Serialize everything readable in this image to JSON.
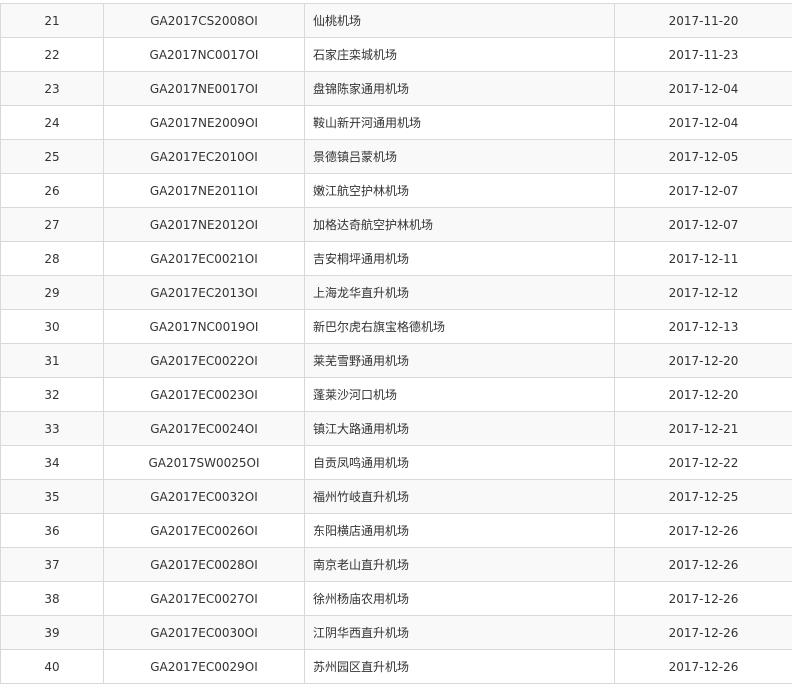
{
  "rows": [
    {
      "no": "21",
      "code": "GA2017CS2008OI",
      "name": "仙桃机场",
      "date": "2017-11-20"
    },
    {
      "no": "22",
      "code": "GA2017NC0017OI",
      "name": "石家庄栾城机场",
      "date": "2017-11-23"
    },
    {
      "no": "23",
      "code": "GA2017NE0017OI",
      "name": "盘锦陈家通用机场",
      "date": "2017-12-04"
    },
    {
      "no": "24",
      "code": "GA2017NE2009OI",
      "name": "鞍山新开河通用机场",
      "date": "2017-12-04"
    },
    {
      "no": "25",
      "code": "GA2017EC2010OI",
      "name": "景德镇吕蒙机场",
      "date": "2017-12-05"
    },
    {
      "no": "26",
      "code": "GA2017NE2011OI",
      "name": "嫩江航空护林机场",
      "date": "2017-12-07"
    },
    {
      "no": "27",
      "code": "GA2017NE2012OI",
      "name": "加格达奇航空护林机场",
      "date": "2017-12-07"
    },
    {
      "no": "28",
      "code": "GA2017EC0021OI",
      "name": "吉安桐坪通用机场",
      "date": "2017-12-11"
    },
    {
      "no": "29",
      "code": "GA2017EC2013OI",
      "name": "上海龙华直升机场",
      "date": "2017-12-12"
    },
    {
      "no": "30",
      "code": "GA2017NC0019OI",
      "name": "新巴尔虎右旗宝格德机场",
      "date": "2017-12-13"
    },
    {
      "no": "31",
      "code": "GA2017EC0022OI",
      "name": "莱芜雪野通用机场",
      "date": "2017-12-20"
    },
    {
      "no": "32",
      "code": "GA2017EC0023OI",
      "name": "蓬莱沙河口机场",
      "date": "2017-12-20"
    },
    {
      "no": "33",
      "code": "GA2017EC0024OI",
      "name": "镇江大路通用机场",
      "date": "2017-12-21"
    },
    {
      "no": "34",
      "code": "GA2017SW0025OI",
      "name": "自贡凤鸣通用机场",
      "date": "2017-12-22"
    },
    {
      "no": "35",
      "code": "GA2017EC0032OI",
      "name": "福州竹岐直升机场",
      "date": "2017-12-25"
    },
    {
      "no": "36",
      "code": "GA2017EC0026OI",
      "name": "东阳横店通用机场",
      "date": "2017-12-26"
    },
    {
      "no": "37",
      "code": "GA2017EC0028OI",
      "name": "南京老山直升机场",
      "date": "2017-12-26"
    },
    {
      "no": "38",
      "code": "GA2017EC0027OI",
      "name": "徐州杨庙农用机场",
      "date": "2017-12-26"
    },
    {
      "no": "39",
      "code": "GA2017EC0030OI",
      "name": "江阴华西直升机场",
      "date": "2017-12-26"
    },
    {
      "no": "40",
      "code": "GA2017EC0029OI",
      "name": "苏州园区直升机场",
      "date": "2017-12-26"
    }
  ]
}
